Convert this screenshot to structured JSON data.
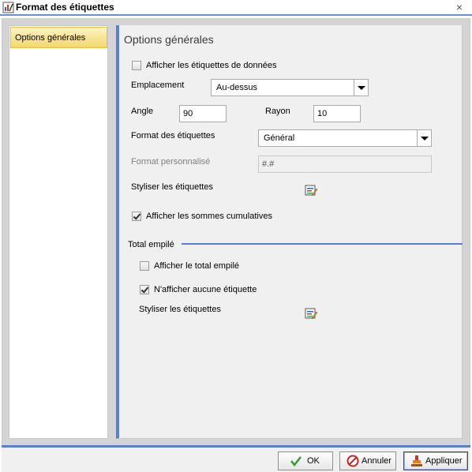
{
  "window": {
    "title": "Format des étiquettes",
    "close_label": "×"
  },
  "nav": {
    "items": [
      {
        "label": "Options générales",
        "selected": true
      }
    ]
  },
  "main": {
    "title": "Options générales",
    "show_data_labels": {
      "label": "Afficher les étiquettes de données",
      "checked": false
    },
    "placement": {
      "label": "Emplacement",
      "value": "Au-dessus"
    },
    "angle": {
      "label": "Angle",
      "value": "90"
    },
    "radius": {
      "label": "Rayon",
      "value": "10"
    },
    "label_format": {
      "label": "Format des étiquettes",
      "value": "Général"
    },
    "custom_format": {
      "label": "Format personnalisé",
      "value": "#.#"
    },
    "style_labels": {
      "label": "Styliser les étiquettes"
    },
    "show_cumulative": {
      "label": "Afficher les sommes cumulatives",
      "checked": true
    }
  },
  "stacked": {
    "section_title": "Total empilé",
    "show_total": {
      "label": "Afficher le total empilé",
      "checked": false
    },
    "no_label": {
      "label": "N'afficher aucune étiquette",
      "checked": true
    },
    "style_labels": {
      "label": "Styliser les étiquettes"
    }
  },
  "footer": {
    "ok_label": "OK",
    "cancel_label": "Annuler",
    "apply_label": "Appliquer"
  },
  "colors": {
    "accent": "#5a7fd0",
    "selected_nav": "#f5d86a"
  }
}
